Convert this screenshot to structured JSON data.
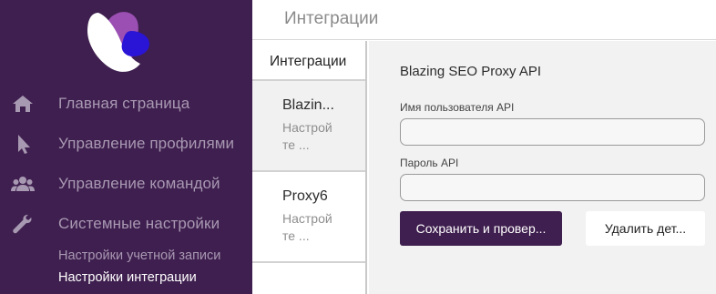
{
  "sidebar": {
    "nav": [
      {
        "label": "Главная страница",
        "icon": "home-icon"
      },
      {
        "label": "Управление профилями",
        "icon": "cursor-icon"
      },
      {
        "label": "Управление командой",
        "icon": "team-icon"
      },
      {
        "label": "Системные настройки",
        "icon": "wrench-icon"
      }
    ],
    "sub": [
      {
        "label": "Настройки учетной записи"
      },
      {
        "label": "Настройки интеграции"
      }
    ]
  },
  "header": {
    "title": "Интеграции"
  },
  "list": {
    "heading": "Интеграции",
    "items": [
      {
        "title": "Blazin...",
        "sub1": "Настрой",
        "sub2": "те ..."
      },
      {
        "title": "Proxy6",
        "sub1": "Настрой",
        "sub2": "те ..."
      }
    ]
  },
  "detail": {
    "title": "Blazing SEO Proxy API",
    "username_label": "Имя пользователя API",
    "username_value": "",
    "password_label": "Пароль API",
    "password_value": "",
    "save_button": "Сохранить и провер...",
    "delete_button": "Удалить дет..."
  },
  "colors": {
    "sidebar_bg": "#3f1f4f",
    "nav_text": "#a899b2",
    "logo_purple": "#9b4fb3",
    "logo_blue": "#2a14d6",
    "primary_button": "#3f1f4f"
  }
}
